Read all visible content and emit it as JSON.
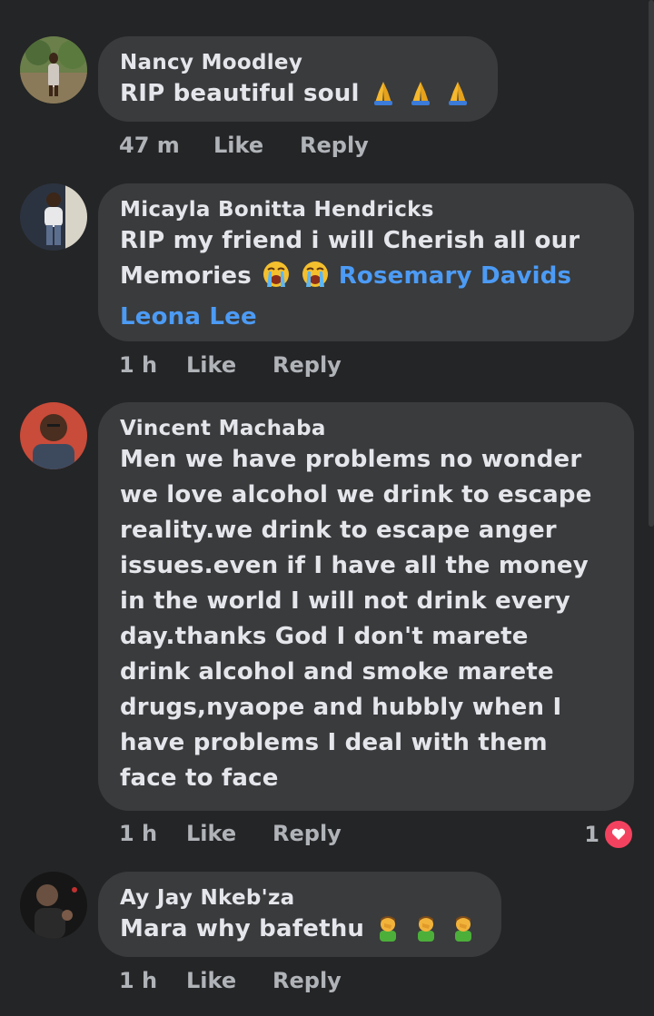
{
  "comments": [
    {
      "author": "Nancy Moodley",
      "text": "RIP beautiful soul",
      "emoji_icon": "folded-hands-icon",
      "time": "47 m",
      "like": "Like",
      "reply": "Reply"
    },
    {
      "author": "Micayla Bonitta Hendricks",
      "text_line1": "RIP my friend i will Cherish all our",
      "text_line2": "Memories",
      "emoji_icon": "loudly-crying-face-icon",
      "mention1": "Rosemary Davids",
      "mention2": "Leona Lee",
      "time": "1 h",
      "like": "Like",
      "reply": "Reply"
    },
    {
      "author": "Vincent Machaba",
      "lines": [
        "Men we have problems no wonder",
        "we love alcohol we drink to escape",
        "reality.we drink to escape anger",
        "issues.even if I have all the money",
        "in the world I will not drink every",
        "day.thanks God I don't marete",
        "drink alcohol and smoke marete",
        "drugs,nyaope and hubbly when I",
        "have problems I deal with them",
        "face to face"
      ],
      "time": "1 h",
      "like": "Like",
      "reply": "Reply",
      "reaction_count": "1",
      "reaction_icon": "heart-icon"
    },
    {
      "author": "Ay Jay Nkeb'za",
      "text": "Mara why bafethu",
      "emoji_icon": "facepalm-man-icon",
      "time": "1 h",
      "like": "Like",
      "reply": "Reply"
    }
  ],
  "colors": {
    "background": "#242526",
    "bubble": "#3a3b3c",
    "text": "#e4e6eb",
    "secondary": "#b0b3b8",
    "mention": "#4c9bf5",
    "heart": "#f3425f"
  }
}
